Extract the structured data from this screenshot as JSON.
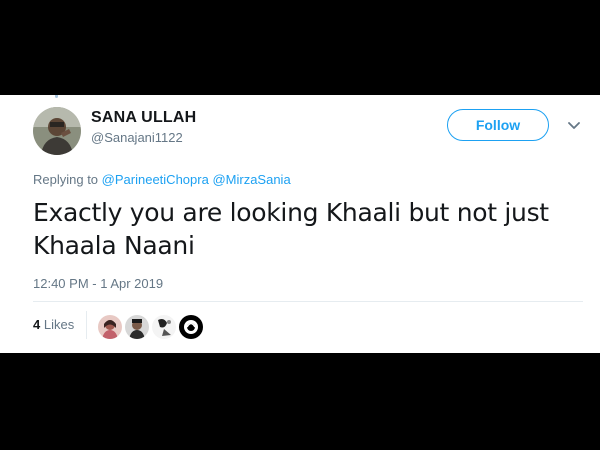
{
  "tweet": {
    "author": {
      "name": "SANA ULLAH",
      "handle": "@Sanajani1122"
    },
    "follow_label": "Follow",
    "replying_prefix": "Replying to",
    "replying_to": [
      "@ParineetiChopra",
      "@MirzaSania"
    ],
    "text": "Exactly you are looking Khaali but not just Khaala Naani",
    "timestamp": "12:40 PM - 1 Apr 2019",
    "likes_count": "4",
    "likes_label": "Likes"
  },
  "colors": {
    "accent": "#1da1f2",
    "muted": "#657786",
    "text": "#14171a",
    "background": "#000000"
  },
  "icons": {
    "menu": "chevron-down-icon"
  }
}
